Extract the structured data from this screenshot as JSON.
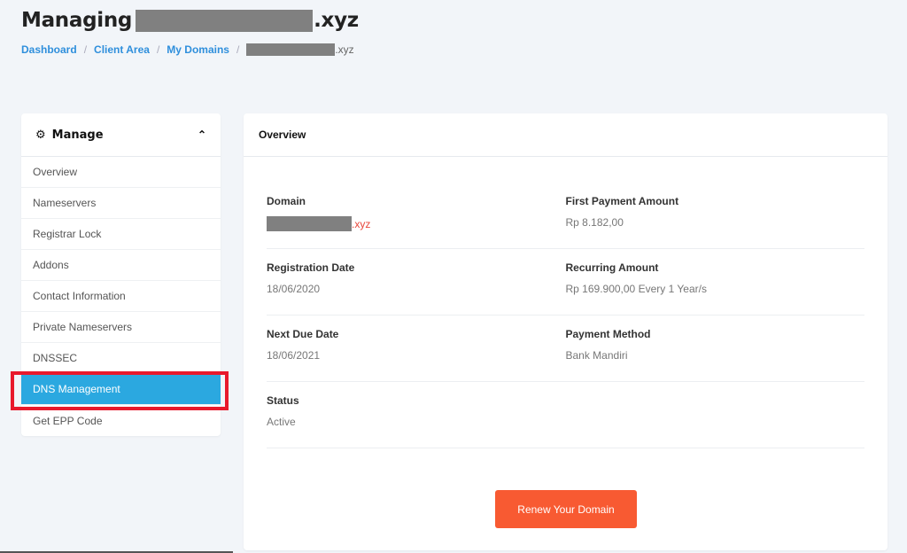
{
  "header": {
    "title_prefix": "Managing",
    "title_suffix": ".xyz"
  },
  "breadcrumb": [
    {
      "label": "Dashboard"
    },
    {
      "label": "Client Area"
    },
    {
      "label": "My Domains"
    }
  ],
  "breadcrumb_sep": "/",
  "breadcrumb_current_suffix": ".xyz",
  "sidebar": {
    "title": "Manage",
    "icon": "gear-icon",
    "toggle_icon": "chevron-up-icon",
    "items": [
      {
        "label": "Overview"
      },
      {
        "label": "Nameservers"
      },
      {
        "label": "Registrar Lock"
      },
      {
        "label": "Addons"
      },
      {
        "label": "Contact Information"
      },
      {
        "label": "Private Nameservers"
      },
      {
        "label": "DNSSEC"
      },
      {
        "label": "DNS Management",
        "active": true
      },
      {
        "label": "Get EPP Code"
      }
    ]
  },
  "overview": {
    "title": "Overview",
    "domain_label": "Domain",
    "domain_tld": ".xyz",
    "first_payment_label": "First Payment Amount",
    "first_payment_value": "Rp 8.182,00",
    "registration_label": "Registration Date",
    "registration_value": "18/06/2020",
    "recurring_label": "Recurring Amount",
    "recurring_value": "Rp 169.900,00 Every 1 Year/s",
    "next_due_label": "Next Due Date",
    "next_due_value": "18/06/2021",
    "payment_method_label": "Payment Method",
    "payment_method_value": "Bank Mandiri",
    "status_label": "Status",
    "status_value": "Active",
    "renew_button": "Renew Your Domain"
  },
  "colors": {
    "accent_blue": "#2ba8e0",
    "link_blue": "#2f8fdc",
    "renew_orange": "#f85a32",
    "highlight_red": "#e8192c"
  }
}
